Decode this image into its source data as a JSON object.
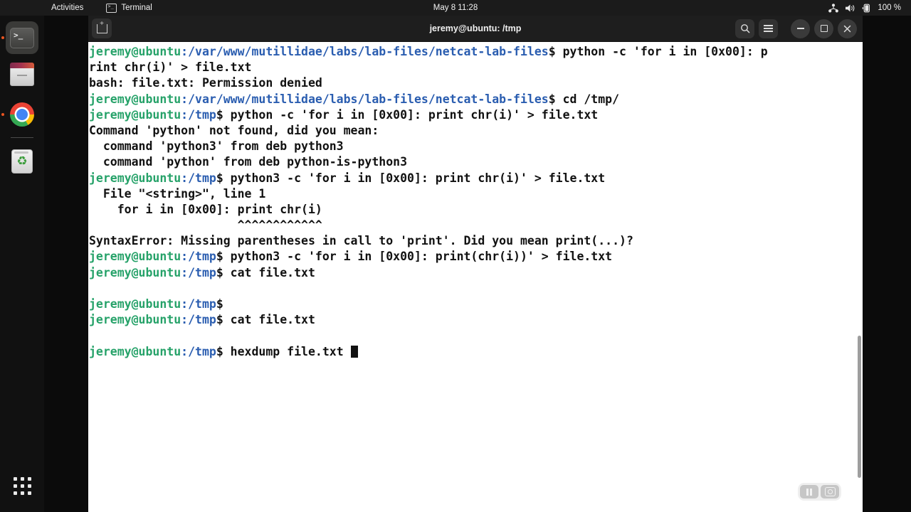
{
  "topbar": {
    "activities": "Activities",
    "app_name": "Terminal",
    "clock": "May 8  11:28",
    "battery_label": "100 %",
    "icons": [
      "network-icon",
      "volume-icon",
      "battery-icon"
    ]
  },
  "dock": {
    "items": [
      {
        "name": "terminal",
        "label": "Terminal",
        "active": true,
        "running": true
      },
      {
        "name": "files",
        "label": "Files",
        "active": false,
        "running": false
      },
      {
        "name": "chrome",
        "label": "Google Chrome",
        "active": false,
        "running": true
      },
      {
        "name": "trash",
        "label": "Trash",
        "active": false,
        "running": false
      }
    ],
    "show_apps_label": "Show Applications"
  },
  "window": {
    "title": "jeremy@ubuntu: /tmp",
    "new_tab_label": "New Tab",
    "search_label": "Search",
    "menu_label": "Menu",
    "minimize_label": "Minimize",
    "maximize_label": "Restore",
    "close_label": "Close"
  },
  "recorder": {
    "pause_label": "Pause recording",
    "screenshot_label": "Take screenshot"
  },
  "colors": {
    "prompt_user": "#26a269",
    "prompt_path": "#2a5db0",
    "text": "#111111",
    "background": "#ffffff",
    "accent": "#e95420"
  },
  "terminal": {
    "prompt_user": "jeremy@ubuntu",
    "cursor": "█",
    "lines": [
      {
        "type": "prompt",
        "path": ":/var/www/mutillidae/labs/lab-files/netcat-lab-files",
        "cmd": "$ python -c 'for i in [0x00]: p"
      },
      {
        "type": "out",
        "text": "rint chr(i)' > file.txt"
      },
      {
        "type": "out",
        "text": "bash: file.txt: Permission denied"
      },
      {
        "type": "prompt",
        "path": ":/var/www/mutillidae/labs/lab-files/netcat-lab-files",
        "cmd": "$ cd /tmp/"
      },
      {
        "type": "prompt",
        "path": ":/tmp",
        "cmd": "$ python -c 'for i in [0x00]: print chr(i)' > file.txt"
      },
      {
        "type": "out",
        "text": "Command 'python' not found, did you mean:"
      },
      {
        "type": "out",
        "text": "  command 'python3' from deb python3"
      },
      {
        "type": "out",
        "text": "  command 'python' from deb python-is-python3"
      },
      {
        "type": "prompt",
        "path": ":/tmp",
        "cmd": "$ python3 -c 'for i in [0x00]: print chr(i)' > file.txt"
      },
      {
        "type": "out",
        "text": "  File \"<string>\", line 1"
      },
      {
        "type": "out",
        "text": "    for i in [0x00]: print chr(i)"
      },
      {
        "type": "out",
        "text": "                     ^^^^^^^^^^^^"
      },
      {
        "type": "out",
        "text": "SyntaxError: Missing parentheses in call to 'print'. Did you mean print(...)?"
      },
      {
        "type": "prompt",
        "path": ":/tmp",
        "cmd": "$ python3 -c 'for i in [0x00]: print(chr(i))' > file.txt"
      },
      {
        "type": "prompt",
        "path": ":/tmp",
        "cmd": "$ cat file.txt"
      },
      {
        "type": "out",
        "text": ""
      },
      {
        "type": "prompt",
        "path": ":/tmp",
        "cmd": "$"
      },
      {
        "type": "prompt",
        "path": ":/tmp",
        "cmd": "$ cat file.txt"
      },
      {
        "type": "out",
        "text": ""
      },
      {
        "type": "prompt",
        "path": ":/tmp",
        "cmd": "$ hexdump file.txt ",
        "cursor": true
      }
    ]
  }
}
